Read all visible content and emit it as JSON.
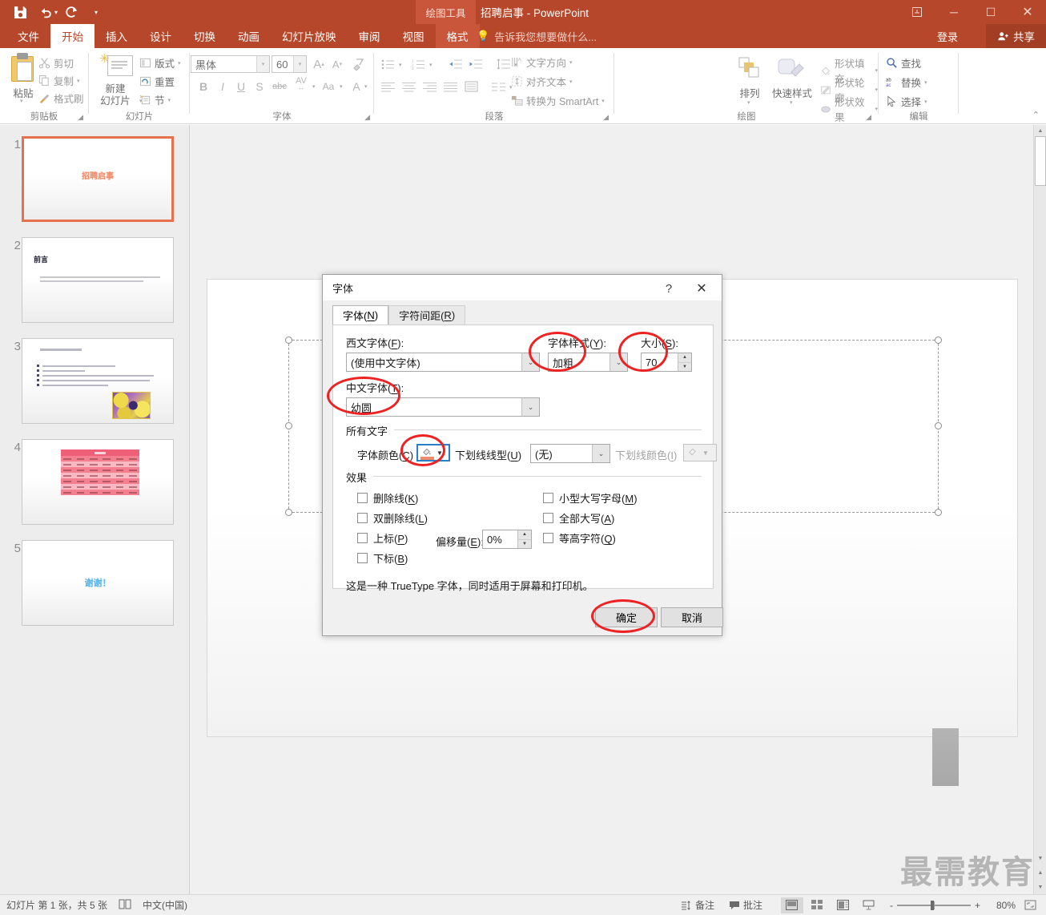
{
  "window": {
    "app_name": "PowerPoint",
    "document_title": "招聘启事",
    "title_full": "招聘启事 - PowerPoint",
    "context_tab_group": "绘图工具",
    "quick_access": [
      {
        "name": "save",
        "glyph": "💾"
      },
      {
        "name": "undo",
        "glyph": "↶"
      },
      {
        "name": "redo",
        "glyph": "↻"
      },
      {
        "name": "customize",
        "glyph": "━"
      }
    ],
    "controls": {
      "minimize": "─",
      "maximize": "☐",
      "close": "✕",
      "ribbon_display": "⬒"
    },
    "signin_label": "登录",
    "share_label": "共享",
    "accent_color": "#b7472a",
    "context_tab_color": "#c9553a"
  },
  "tabs": [
    {
      "label": "文件",
      "active": false
    },
    {
      "label": "开始",
      "active": true
    },
    {
      "label": "插入",
      "active": false
    },
    {
      "label": "设计",
      "active": false
    },
    {
      "label": "切换",
      "active": false
    },
    {
      "label": "动画",
      "active": false
    },
    {
      "label": "幻灯片放映",
      "active": false
    },
    {
      "label": "审阅",
      "active": false
    },
    {
      "label": "视图",
      "active": false
    },
    {
      "label": "格式",
      "active": false,
      "contextual": true
    }
  ],
  "tell_me": "告诉我您想要做什么...",
  "ribbon": {
    "groups": [
      {
        "name": "clipboard",
        "label": "剪贴板"
      },
      {
        "name": "slides",
        "label": "幻灯片"
      },
      {
        "name": "font",
        "label": "字体"
      },
      {
        "name": "paragraph",
        "label": "段落"
      },
      {
        "name": "drawing",
        "label": "绘图"
      },
      {
        "name": "editing",
        "label": "编辑"
      }
    ],
    "clipboard": {
      "paste": "粘贴",
      "cut": "剪切",
      "copy": "复制",
      "format_painter": "格式刷"
    },
    "slides": {
      "new_slide": "新建\n幻灯片",
      "new_slide_line1": "新建",
      "new_slide_line2": "幻灯片",
      "layout": "版式",
      "reset": "重置",
      "section": "节"
    },
    "font": {
      "font_name": "黑体",
      "font_size": "60",
      "grow_font": "A",
      "shrink_font": "A",
      "clear_formatting": "✐",
      "bold": "B",
      "italic": "I",
      "underline": "U",
      "shadow": "S",
      "strikethrough": "abc",
      "char_spacing": "AV",
      "change_case": "Aa",
      "font_color": "A"
    },
    "paragraph": {
      "text_direction": "文字方向",
      "align_text": "对齐文本",
      "convert_smartart": "转换为 SmartArt"
    },
    "drawing": {
      "arrange": "排列",
      "quick_styles": "快速样式",
      "shape_fill": "形状填充",
      "shape_outline": "形状轮廓",
      "shape_effects": "形状效果"
    },
    "editing": {
      "find": "查找",
      "replace": "替换",
      "select": "选择"
    }
  },
  "slides_panel": {
    "slides": [
      {
        "number": "1",
        "title": "招聘启事",
        "selected": true
      },
      {
        "number": "2",
        "title": "前言",
        "selected": false
      },
      {
        "number": "3",
        "title": "",
        "selected": false
      },
      {
        "number": "4",
        "title": "",
        "selected": false
      },
      {
        "number": "5",
        "title": "谢谢！",
        "selected": false
      }
    ]
  },
  "dialog": {
    "title": "字体",
    "help_glyph": "?",
    "close_glyph": "✕",
    "tabs": [
      {
        "label": "字体(N)",
        "label_pre": "字体(",
        "accel": "N",
        "label_post": ")",
        "active": true
      },
      {
        "label": "字符间距(R)",
        "label_pre": "字符间距(",
        "accel": "R",
        "label_post": ")",
        "active": false
      }
    ],
    "latin_font_label_pre": "西文字体(",
    "latin_font_accel": "F",
    "latin_font_label_post": "):",
    "latin_font_value": "(使用中文字体)",
    "font_style_label_pre": "字体样式(",
    "font_style_accel": "Y",
    "font_style_label_post": "):",
    "font_style_value": "加粗",
    "size_label_pre": "大小(",
    "size_accel": "S",
    "size_label_post": "):",
    "size_value": "70",
    "cjk_font_label_pre": "中文字体(",
    "cjk_font_accel": "T",
    "cjk_font_label_post": "):",
    "cjk_font_value": "幼圆",
    "all_text_group": "所有文字",
    "font_color_label_pre": "字体颜色(",
    "font_color_accel": "C",
    "font_color_label_post": ")",
    "font_color_value": "#f08b6a",
    "underline_style_label_pre": "下划线线型(",
    "underline_style_accel": "U",
    "underline_style_label_post": ")",
    "underline_style_value": "(无)",
    "underline_color_label_pre": "下划线颜色(",
    "underline_color_accel": "I",
    "underline_color_label_post": ")",
    "effects_group": "效果",
    "effects": [
      {
        "label_pre": "删除线(",
        "accel": "K",
        "label_post": ")",
        "checked": false
      },
      {
        "label_pre": "双删除线(",
        "accel": "L",
        "label_post": ")",
        "checked": false
      },
      {
        "label_pre": "上标(",
        "accel": "P",
        "label_post": ")",
        "checked": false
      },
      {
        "label_pre": "下标(",
        "accel": "B",
        "label_post": ")",
        "checked": false
      },
      {
        "label_pre": "小型大写字母(",
        "accel": "M",
        "label_post": ")",
        "checked": false
      },
      {
        "label_pre": "全部大写(",
        "accel": "A",
        "label_post": ")",
        "checked": false
      },
      {
        "label_pre": "等高字符(",
        "accel": "Q",
        "label_post": ")",
        "checked": false
      }
    ],
    "offset_label_pre": "偏移量(",
    "offset_accel": "E",
    "offset_label_post": "):",
    "offset_value": "0%",
    "truetype_note": "这是一种 TrueType 字体，同时适用于屏幕和打印机。",
    "ok_label": "确定",
    "cancel_label": "取消",
    "annotation_color": "#ee2222"
  },
  "status_bar": {
    "slide_position": "幻灯片 第 1 张，共 5 张",
    "spellcheck_icon": "📖",
    "language": "中文(中国)",
    "notes_label": "备注",
    "comments_label": "批注",
    "view_normal": "▣",
    "view_sorter": "▒",
    "view_reading": "▥",
    "view_slideshow": "▽",
    "zoom_out": "-",
    "zoom_in": "+",
    "zoom_level": "80%",
    "fit_slide": "⛶"
  },
  "watermark": "最需教育"
}
